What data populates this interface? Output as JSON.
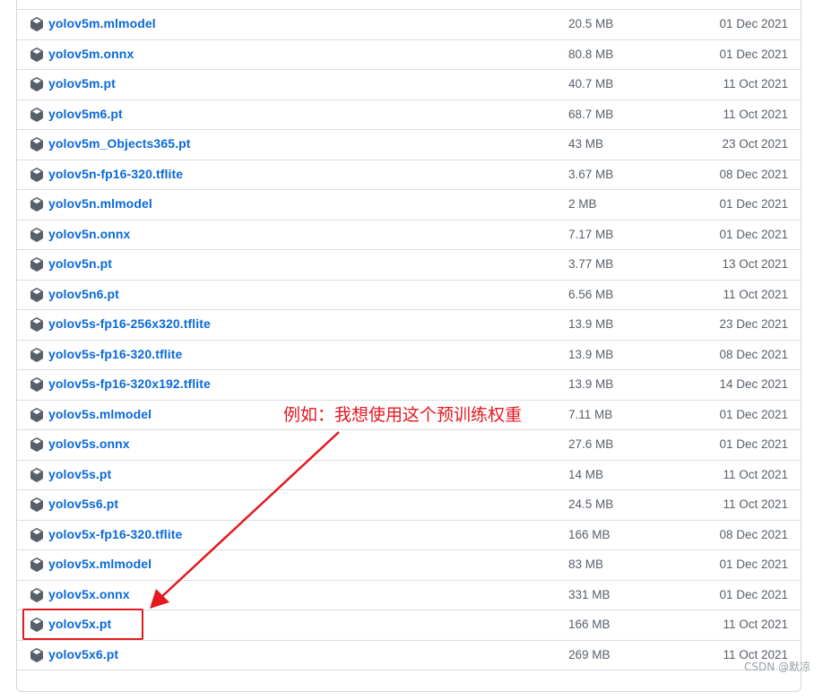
{
  "assets": [
    {
      "name": "yolov5m.mlmodel",
      "size": "20.5 MB",
      "date": "01 Dec 2021"
    },
    {
      "name": "yolov5m.onnx",
      "size": "80.8 MB",
      "date": "01 Dec 2021"
    },
    {
      "name": "yolov5m.pt",
      "size": "40.7 MB",
      "date": "11 Oct 2021"
    },
    {
      "name": "yolov5m6.pt",
      "size": "68.7 MB",
      "date": "11 Oct 2021"
    },
    {
      "name": "yolov5m_Objects365.pt",
      "size": "43 MB",
      "date": "23 Oct 2021"
    },
    {
      "name": "yolov5n-fp16-320.tflite",
      "size": "3.67 MB",
      "date": "08 Dec 2021"
    },
    {
      "name": "yolov5n.mlmodel",
      "size": "2 MB",
      "date": "01 Dec 2021"
    },
    {
      "name": "yolov5n.onnx",
      "size": "7.17 MB",
      "date": "01 Dec 2021"
    },
    {
      "name": "yolov5n.pt",
      "size": "3.77 MB",
      "date": "13 Oct 2021"
    },
    {
      "name": "yolov5n6.pt",
      "size": "6.56 MB",
      "date": "11 Oct 2021"
    },
    {
      "name": "yolov5s-fp16-256x320.tflite",
      "size": "13.9 MB",
      "date": "23 Dec 2021"
    },
    {
      "name": "yolov5s-fp16-320.tflite",
      "size": "13.9 MB",
      "date": "08 Dec 2021"
    },
    {
      "name": "yolov5s-fp16-320x192.tflite",
      "size": "13.9 MB",
      "date": "14 Dec 2021"
    },
    {
      "name": "yolov5s.mlmodel",
      "size": "7.11 MB",
      "date": "01 Dec 2021"
    },
    {
      "name": "yolov5s.onnx",
      "size": "27.6 MB",
      "date": "01 Dec 2021"
    },
    {
      "name": "yolov5s.pt",
      "size": "14 MB",
      "date": "11 Oct 2021"
    },
    {
      "name": "yolov5s6.pt",
      "size": "24.5 MB",
      "date": "11 Oct 2021"
    },
    {
      "name": "yolov5x-fp16-320.tflite",
      "size": "166 MB",
      "date": "08 Dec 2021"
    },
    {
      "name": "yolov5x.mlmodel",
      "size": "83 MB",
      "date": "01 Dec 2021"
    },
    {
      "name": "yolov5x.onnx",
      "size": "331 MB",
      "date": "01 Dec 2021"
    },
    {
      "name": "yolov5x.pt",
      "size": "166 MB",
      "date": "11 Oct 2021"
    },
    {
      "name": "yolov5x6.pt",
      "size": "269 MB",
      "date": "11 Oct 2021"
    }
  ],
  "annotation": {
    "text": "例如：我想使用这个预训练权重",
    "color": "#e3191f"
  },
  "watermark": "CSDN @默凉",
  "colors": {
    "link": "#0969da",
    "muted": "#57606a",
    "border": "#d8dee4"
  },
  "icons": {
    "asset": "package-icon"
  }
}
